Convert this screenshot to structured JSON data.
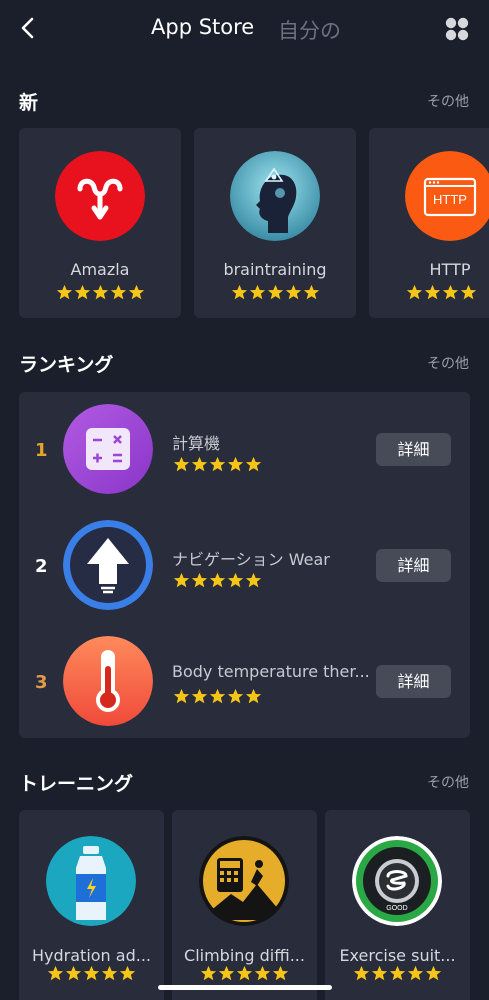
{
  "header": {
    "tab_app_store": "App Store",
    "tab_mine": "自分の"
  },
  "new_section": {
    "title": "新",
    "more": "その他",
    "apps": [
      {
        "name": "Amazla",
        "stars": 5
      },
      {
        "name": "braintraining",
        "stars": 5
      },
      {
        "name": "HTTP",
        "icon_text": "HTTP",
        "stars": 5
      }
    ]
  },
  "ranking_section": {
    "title": "ランキング",
    "more": "その他",
    "items": [
      {
        "rank": "1",
        "name": "計算機",
        "stars": 5,
        "button": "詳細"
      },
      {
        "rank": "2",
        "name": "ナビゲーション Wear",
        "stars": 5,
        "button": "詳細"
      },
      {
        "rank": "3",
        "name": "Body temperature ther...",
        "stars": 5,
        "button": "詳細"
      }
    ]
  },
  "training_section": {
    "title": "トレーニング",
    "more": "その他",
    "apps": [
      {
        "name": "Hydration ad...",
        "stars": 5
      },
      {
        "name": "Climbing diffi...",
        "stars": 5
      },
      {
        "name": "Exercise suit...",
        "icon_text": "GOOD",
        "stars": 5
      }
    ]
  },
  "colors": {
    "background": "#1b1f2c",
    "card": "#282c3b",
    "star": "#f5c518",
    "rank_1": "#e3a62a",
    "rank_2": "#ffffff",
    "rank_3": "#e39a46"
  }
}
